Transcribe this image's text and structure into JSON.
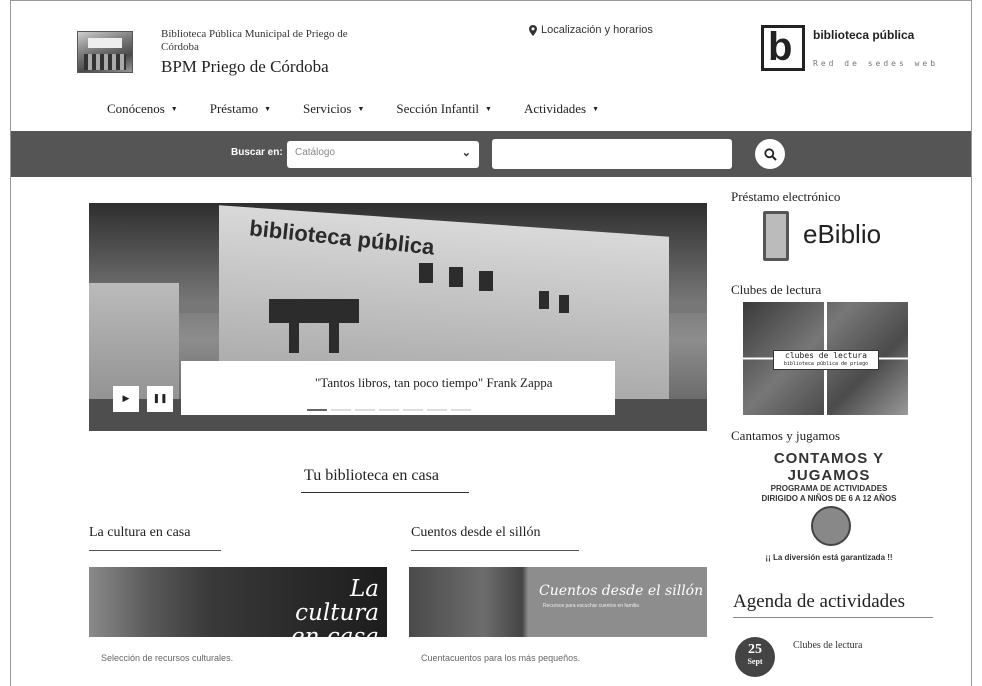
{
  "header": {
    "subtitle": "Biblioteca Pública Municipal de Priego de Córdoba",
    "title": "BPM Priego de Córdoba",
    "location_link": "Localización y horarios",
    "brand_title": "biblioteca pública",
    "brand_subtitle": "Red de sedes web",
    "brand_letter": "b"
  },
  "nav": [
    {
      "label": "Conócenos"
    },
    {
      "label": "Préstamo"
    },
    {
      "label": "Servicios"
    },
    {
      "label": "Sección Infantil"
    },
    {
      "label": "Actividades"
    }
  ],
  "search": {
    "label": "Buscar en:",
    "select_value": "Catálogo",
    "input_value": ""
  },
  "hero": {
    "sign": "biblioteca pública",
    "caption": "\"Tantos libros, tan poco tiempo\" Frank Zappa",
    "slide_count": 7,
    "active_slide": 0
  },
  "sidebar": {
    "prestamo_title": "Préstamo electrónico",
    "ebiblio_logo": "eBiblio",
    "clubes_title": "Clubes de lectura",
    "clubes_image_text": "clubes de lectura",
    "clubes_image_subtext": "biblioteca pública de priego",
    "cantamos_title": "Cantamos y jugamos",
    "cantamos_image": {
      "headline": "CONTAMOS Y JUGAMOS",
      "line1": "PROGRAMA DE ACTIVIDADES",
      "line2": "DIRIGIDO A NIÑOS DE 6 A 12 AÑOS",
      "footer": "¡¡ La diversión está garantizada !!"
    },
    "agenda_title": "Agenda de actividades",
    "agenda_items": [
      {
        "day": "25",
        "month": "Sept",
        "title": "Clubes de lectura"
      }
    ]
  },
  "main": {
    "section_title": "Tu biblioteca en casa",
    "col1": {
      "title": "La cultura en casa",
      "banner_line1": "La cultura",
      "banner_line2": "en casa",
      "description": "Selección de recursos culturales."
    },
    "col2": {
      "title": "Cuentos desde el sillón",
      "banner_text": "Cuentos desde el sillón",
      "banner_sub": "Recursos para escuchar cuentos en familia",
      "description": "Cuentacuentos para los más pequeños."
    }
  }
}
